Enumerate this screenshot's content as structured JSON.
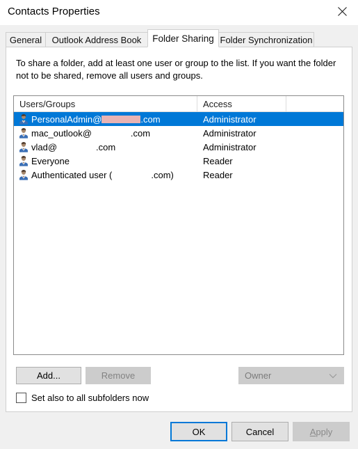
{
  "window": {
    "title": "Contacts Properties",
    "close_icon": "close-icon"
  },
  "tabs": [
    {
      "label": "General",
      "active": false
    },
    {
      "label": "Outlook Address Book",
      "active": false
    },
    {
      "label": "Folder Sharing",
      "active": true
    },
    {
      "label": "Folder Synchronization",
      "active": false
    }
  ],
  "panel": {
    "description": "To share a folder, add at least one user or group to the list. If you want the folder not to be shared, remove all users and groups."
  },
  "list": {
    "columns": [
      "Users/Groups",
      "Access",
      ""
    ],
    "rows": [
      {
        "icon": "user-icon",
        "name_prefix": "PersonalAdmin@",
        "redacted": true,
        "redaction_width": 56,
        "redaction_color": "#e8b3b3",
        "name_suffix": ".com",
        "access": "Administrator",
        "selected": true
      },
      {
        "icon": "user-icon",
        "name_prefix": "mac_outlook@",
        "redacted": true,
        "redaction_width": 56,
        "redaction_color": "#ffffff",
        "name_suffix": ".com",
        "access": "Administrator",
        "selected": false
      },
      {
        "icon": "user-icon",
        "name_prefix": "vlad@",
        "redacted": true,
        "redaction_width": 56,
        "redaction_color": "#ffffff",
        "name_suffix": ".com",
        "access": "Administrator",
        "selected": false
      },
      {
        "icon": "user-icon",
        "name_prefix": "Everyone",
        "redacted": false,
        "redaction_width": 0,
        "redaction_color": "#ffffff",
        "name_suffix": "",
        "access": "Reader",
        "selected": false
      },
      {
        "icon": "user-icon",
        "name_prefix": "Authenticated user (",
        "redacted": true,
        "redaction_width": 56,
        "redaction_color": "#ffffff",
        "name_suffix": ".com)",
        "access": "Reader",
        "selected": false
      }
    ]
  },
  "actions": {
    "add_label": "Add...",
    "remove_label": "Remove",
    "remove_disabled": true,
    "owner_select_value": "Owner",
    "owner_select_disabled": true,
    "owner_chevron_icon": "chevron-down-icon",
    "subfolders_label": "Set also to all subfolders now",
    "subfolders_checked": false
  },
  "footer": {
    "ok_label": "OK",
    "cancel_label": "Cancel",
    "apply_label_pre": "A",
    "apply_label_post": "pply",
    "apply_disabled": true
  },
  "colors": {
    "accent": "#0078d7",
    "dialog_bg": "#f0f0f0",
    "panel_bg": "#ffffff",
    "disabled_text": "#838383",
    "list_border": "#8a8a8a"
  }
}
